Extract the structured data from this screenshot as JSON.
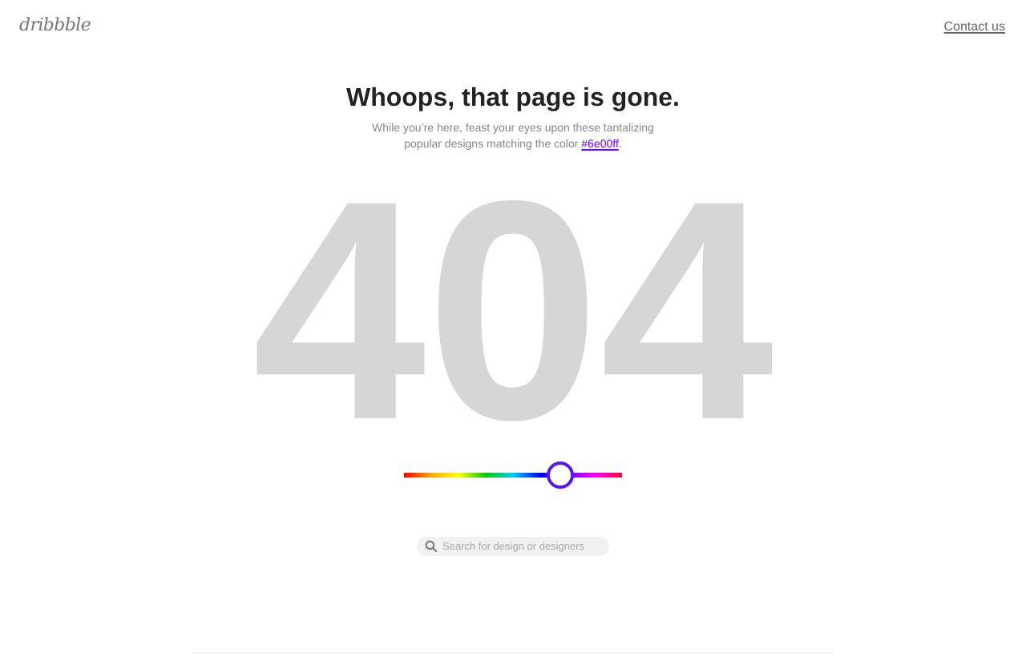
{
  "header": {
    "logo": "dribbble",
    "contact_link": "Contact us"
  },
  "title": "Whoops, that page is gone.",
  "message": {
    "text": "While you’re here, feast your eyes upon these tantalizing popular designs matching the color",
    "link": "#6e00ff",
    "end": "."
  },
  "error_code": "404",
  "color_slider": {
    "level": 0.71
  },
  "search": {
    "placeholder": "Search for design or designers"
  }
}
